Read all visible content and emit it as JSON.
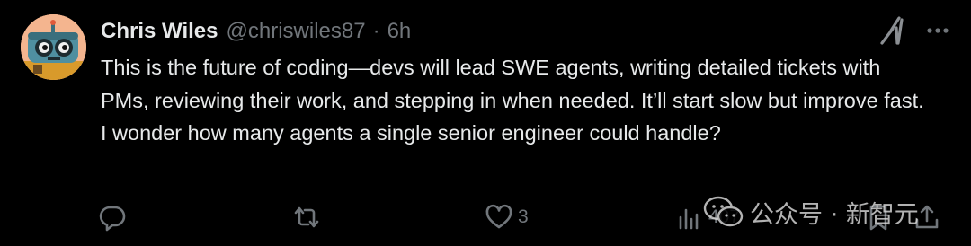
{
  "tweet": {
    "author": {
      "display_name": "Chris Wiles",
      "handle": "@chriswiles87"
    },
    "separator": "·",
    "time": "6h",
    "text": "This is the future of coding—devs will lead SWE agents, writing detailed tickets with PMs, reviewing their work, and stepping in when needed. It’ll start slow but improve fast. I wonder how many agents a single senior engineer could handle?",
    "icons": {
      "grok": "grok-icon",
      "more": "more-icon",
      "reply": "reply-icon",
      "retweet": "retweet-icon",
      "like": "heart-icon",
      "views": "views-icon",
      "bookmark": "bookmark-icon",
      "share": "share-icon"
    },
    "actions": {
      "likes": "3",
      "views": "407"
    }
  },
  "watermark": {
    "text": "公众号 · 新智元"
  },
  "colors": {
    "background": "#000000",
    "text": "#e7e9ea",
    "secondary": "#71767b"
  }
}
